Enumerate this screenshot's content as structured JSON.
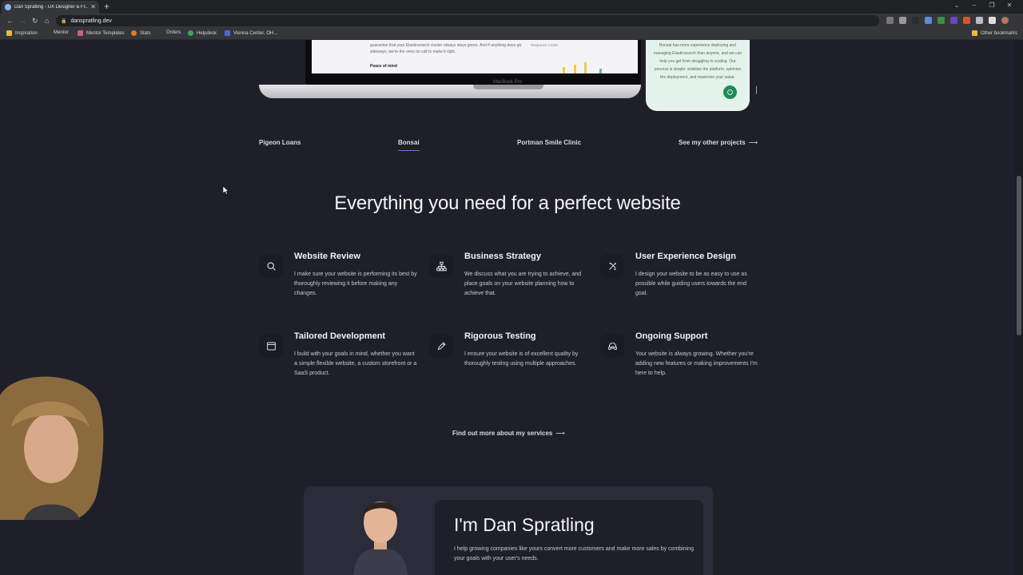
{
  "browser": {
    "tab_title": "Dan Spratling - UX Designer & Fr...",
    "url": "danspratling.dev",
    "bookmarks": [
      "Inspiration",
      "Mentor",
      "Mentor Templates",
      "Stats",
      "Orders",
      "Helpdesk",
      "Vienna Center, OH...",
      "Other bookmarks"
    ]
  },
  "mockup": {
    "laptop_text": "guarantee that your Elasticsearch cluster always stays green. And if anything does go sideways, we're the ones on call to make it right.",
    "laptop_heading": "Peace of mind",
    "laptop_chart_label": "Response Codes",
    "laptop_brand": "MacBook Pro",
    "phone_text": "Bonsai has more experience deploying and managing Elasticsearch than anyone, and we can help you get from struggling to scaling. Our process is simple: stabilize the platform, optimize the deployment, and maximize your value."
  },
  "projects": {
    "tabs": [
      "Pigeon Loans",
      "Bonsai",
      "Portman Smile Clinic"
    ],
    "active": "Bonsai",
    "other_link": "See my other projects"
  },
  "services": {
    "heading": "Everything you need for a perfect website",
    "items": [
      {
        "icon": "search-icon",
        "title": "Website Review",
        "desc": "I make sure your website is performing its best by thoroughly reviewing it before making any changes."
      },
      {
        "icon": "sitemap-icon",
        "title": "Business Strategy",
        "desc": "We discuss what you are trying to achieve, and place goals on your website planning how to achieve that."
      },
      {
        "icon": "design-tools-icon",
        "title": "User Experience Design",
        "desc": "I design your website to be as easy to use as possible while guiding users towards the end goal."
      },
      {
        "icon": "browser-window-icon",
        "title": "Tailored Development",
        "desc": "I build with your goals in mind, whether you want a simple flexible website, a custom storefront or a SaaS product."
      },
      {
        "icon": "pencil-icon",
        "title": "Rigorous Testing",
        "desc": "I ensure your website is of excellent quality by thoroughly testing using multiple approaches."
      },
      {
        "icon": "support-icon",
        "title": "Ongoing Support",
        "desc": "Your website is always growing. Whether you're adding new features or making improvements I'm here to help."
      }
    ],
    "cta": "Find out more about my services"
  },
  "about": {
    "name": "I'm Dan Spratling",
    "desc": "I help growing companies like yours convert more customers and make more sales by combining your goals with your user's needs."
  },
  "colors": {
    "page_bg": "#1e1f29",
    "accent": "#6f72c9",
    "card_bg": "#2a2c39"
  }
}
